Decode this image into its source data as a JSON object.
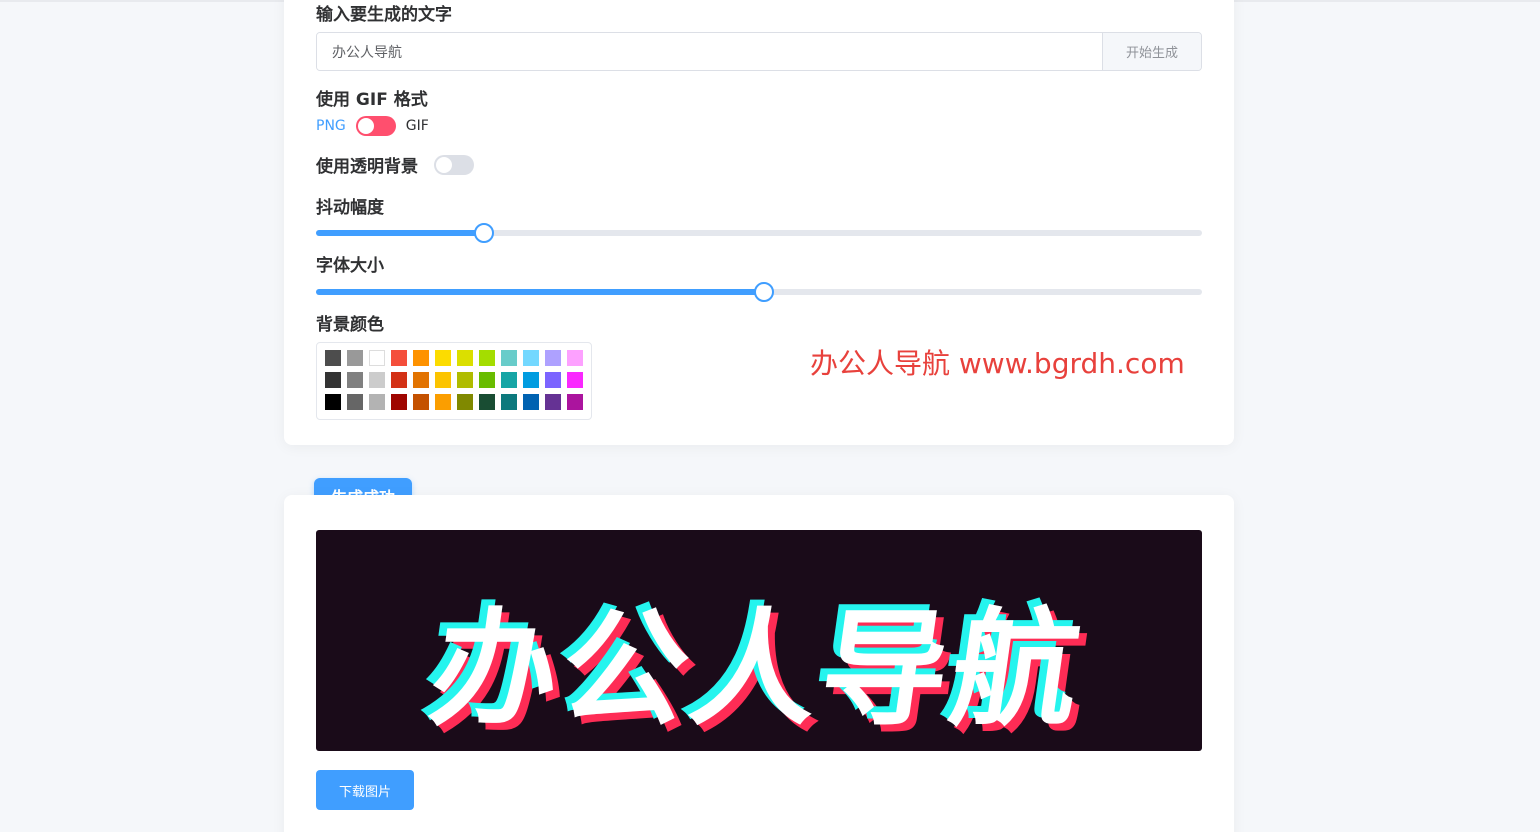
{
  "form": {
    "text_label": "输入要生成的文字",
    "text_value": "办公人导航",
    "generate_button": "开始生成",
    "gif_label": "使用 GIF 格式",
    "format_left": "PNG",
    "format_right": "GIF",
    "gif_enabled": false,
    "transparent_label": "使用透明背景",
    "transparent_enabled": false,
    "shake_label": "抖动幅度",
    "shake_value_fraction": 0.19,
    "font_size_label": "字体大小",
    "font_size_value_fraction": 0.506,
    "bg_color_label": "背景颜色",
    "palette": [
      [
        "#4d4d4d",
        "#999999",
        "#ffffff",
        "#f44e3b",
        "#fe9200",
        "#fcdc00",
        "#dbdf00",
        "#a4dd00",
        "#68ccca",
        "#73d8ff",
        "#aea1ff",
        "#fda1ff"
      ],
      [
        "#333333",
        "#808080",
        "#cccccc",
        "#d33115",
        "#e27300",
        "#fcc400",
        "#b0bc00",
        "#68bc00",
        "#16a5a5",
        "#009ce0",
        "#7b64ff",
        "#fa28ff"
      ],
      [
        "#000000",
        "#666666",
        "#b3b3b3",
        "#9f0500",
        "#c45100",
        "#fb9e00",
        "#808900",
        "#194d33",
        "#0c797d",
        "#0062b1",
        "#653294",
        "#ab149e"
      ]
    ]
  },
  "watermark": "办公人导航 www.bgrdh.com",
  "result": {
    "badge": "生成成功",
    "image_text": "办公人导航",
    "download_button": "下载图片"
  },
  "colors": {
    "accent": "#409eff",
    "switch_on": "#ff4f6e",
    "watermark": "#e8413c",
    "image_bg": "#1a0b19",
    "glitch_red": "#fe2c55",
    "glitch_cyan": "#25f4ee"
  }
}
